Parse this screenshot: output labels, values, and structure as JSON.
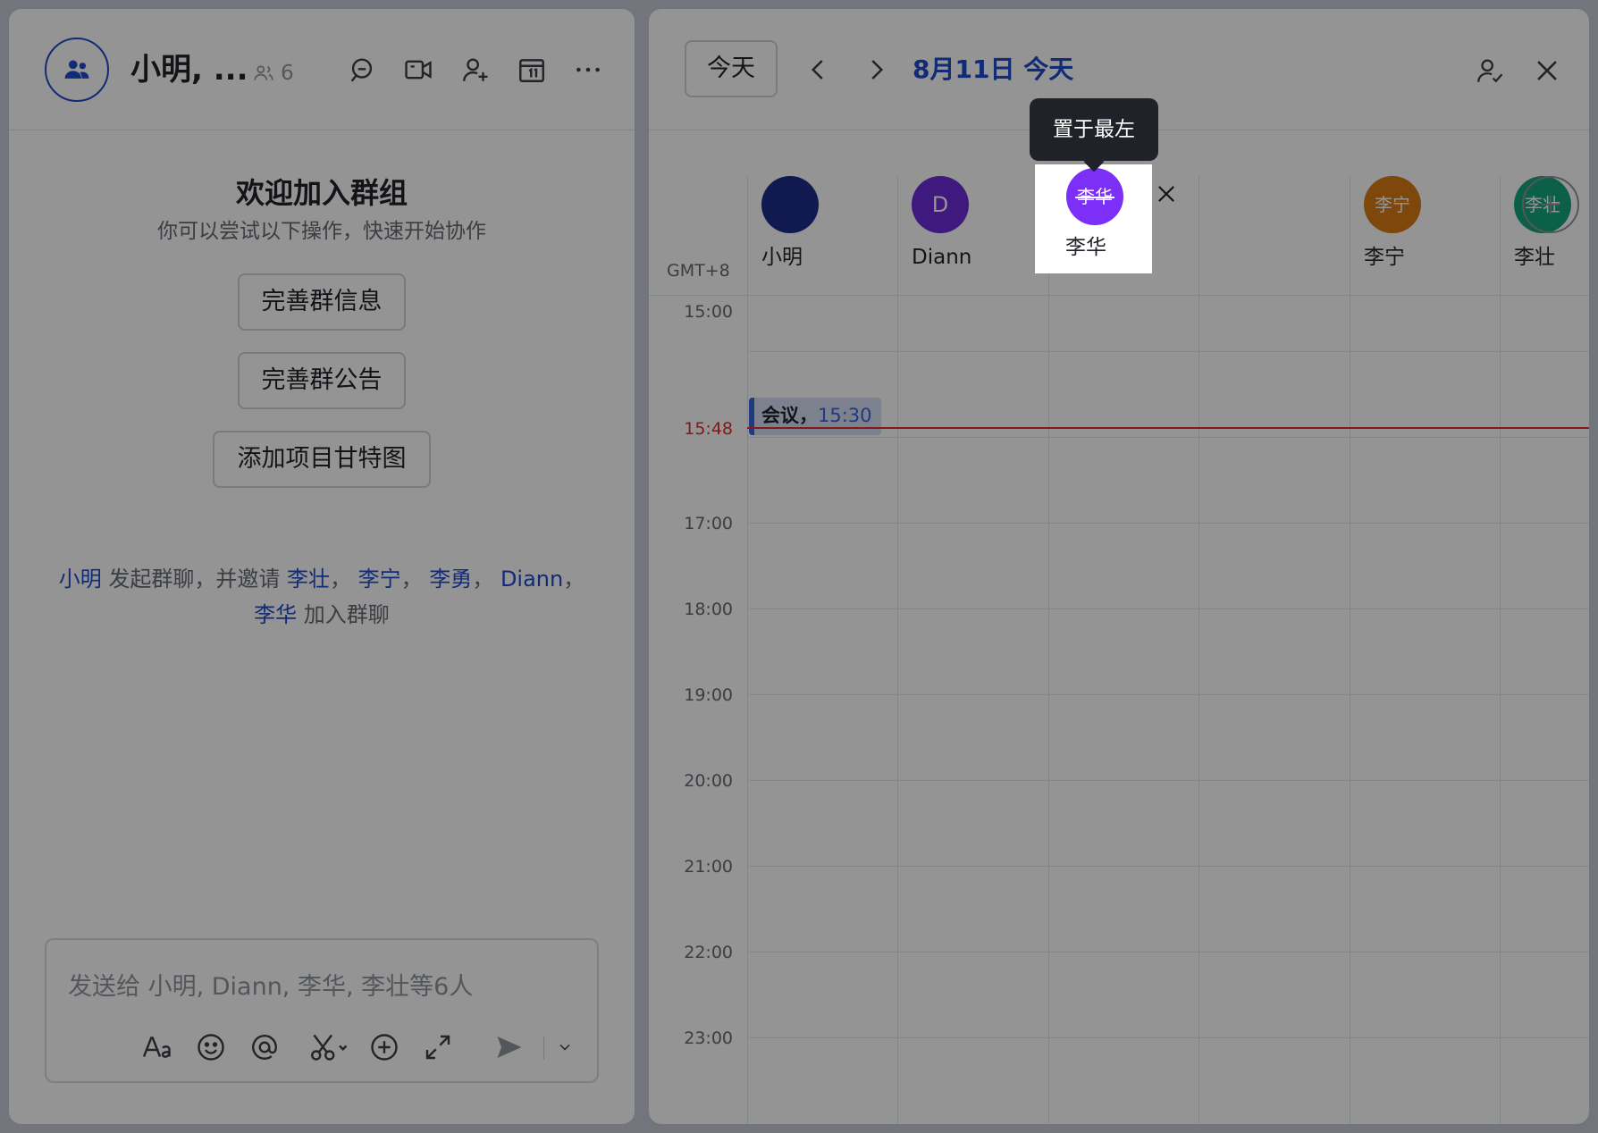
{
  "chat": {
    "title": "小明, ...",
    "member_count": "6",
    "welcome_title": "欢迎加入群组",
    "welcome_subtitle": "你可以尝试以下操作，快速开始协作",
    "actions": [
      "完善群信息",
      "完善群公告",
      "添加项目甘特图"
    ],
    "system_message": {
      "starter": "小明",
      "text_started": " 发起群聊，并邀请 ",
      "invitee_1": "李壮",
      "sep_1": "，",
      "invitee_2": "李宁",
      "sep_2": "，",
      "invitee_3": "李勇",
      "sep_3": "，",
      "invitee_4": "Diann",
      "sep_4": "，",
      "invitee_5": "李华",
      "text_joined": " 加入群聊"
    },
    "composer_placeholder": "发送给 小明, Diann, 李华, 李壮等6人"
  },
  "calendar": {
    "today_button": "今天",
    "date_label": "8月11日 今天",
    "timezone": "GMT+8",
    "people": [
      {
        "name": "小明",
        "avatar_text": "",
        "color": "#1e2e8a"
      },
      {
        "name": "Diann",
        "avatar_text": "D",
        "color": "#6f2bd9"
      },
      {
        "name": "李华",
        "avatar_text": "李华",
        "color": "#7b2ff7"
      },
      {
        "name": "李宁",
        "avatar_text": "李宁",
        "color": "#d97b14"
      },
      {
        "name": "李壮",
        "avatar_text": "李壮",
        "color": "#16a57a"
      }
    ],
    "hours": [
      "15:00",
      "17:00",
      "18:00",
      "19:00",
      "20:00",
      "21:00",
      "22:00",
      "23:00"
    ],
    "current_time": "15:48",
    "event": {
      "title": "会议，",
      "time": "15:30"
    },
    "tooltip": "置于最左"
  }
}
